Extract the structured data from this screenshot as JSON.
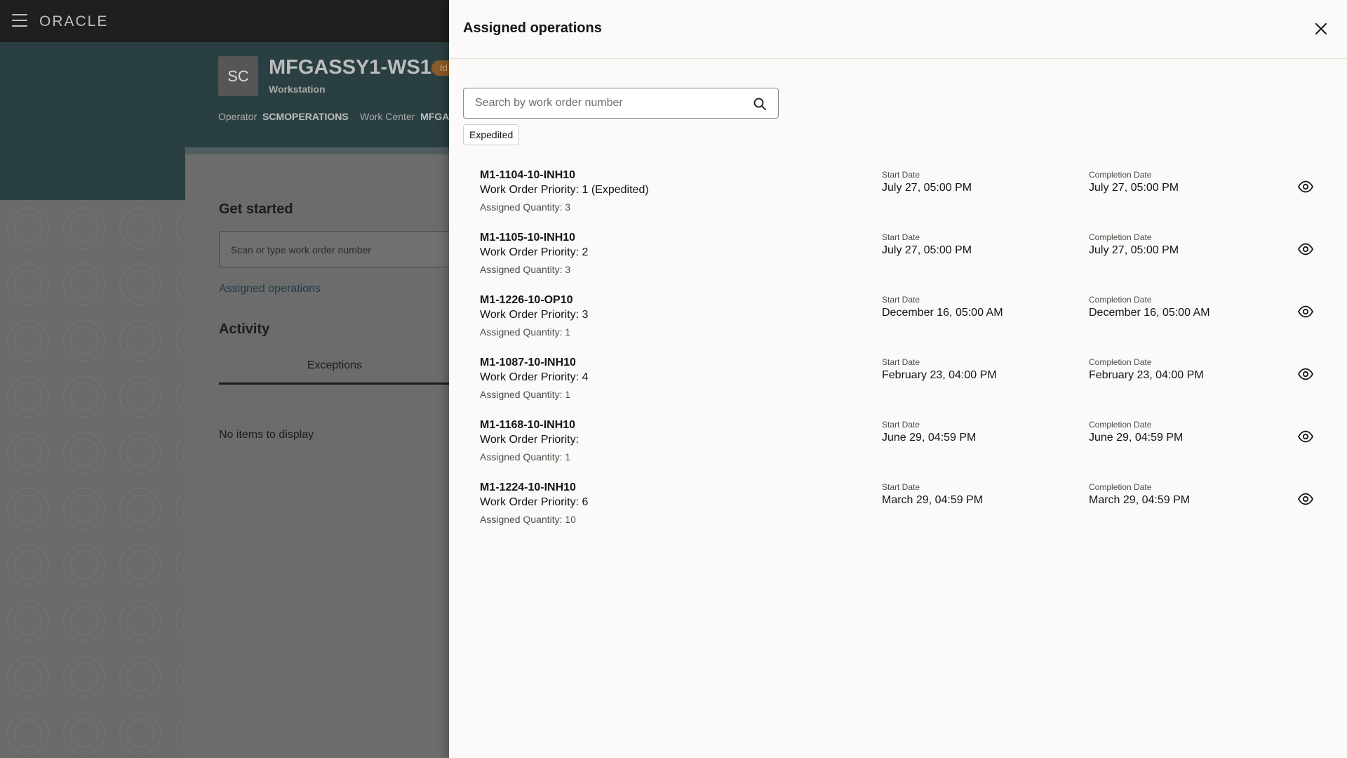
{
  "topbar": {
    "logo": "ORACLE"
  },
  "workstation": {
    "avatar": "SC",
    "name": "MFGASSY1-WS1",
    "badge": "Id",
    "type": "Workstation",
    "operator_label": "Operator",
    "operator_value": "SCMOPERATIONS",
    "work_center_label": "Work Center",
    "work_center_value": "MFGAS"
  },
  "background": {
    "get_started": "Get started",
    "scan_placeholder": "Scan or type work order number",
    "assigned_link": "Assigned operations",
    "activity": "Activity",
    "tab_exceptions": "Exceptions",
    "no_items": "No items to display"
  },
  "drawer": {
    "title": "Assigned operations",
    "search_placeholder": "Search by work order number",
    "chip": "Expedited",
    "start_label": "Start Date",
    "completion_label": "Completion Date",
    "rows": [
      {
        "number": "M1-1104-10-INH10",
        "priority": "Work Order Priority: 1 (Expedited)",
        "quantity": "Assigned Quantity: 3",
        "start": "July 27, 05:00 PM",
        "completion": "July 27, 05:00 PM"
      },
      {
        "number": "M1-1105-10-INH10",
        "priority": "Work Order Priority: 2",
        "quantity": "Assigned Quantity: 3",
        "start": "July 27, 05:00 PM",
        "completion": "July 27, 05:00 PM"
      },
      {
        "number": "M1-1226-10-OP10",
        "priority": "Work Order Priority: 3",
        "quantity": "Assigned Quantity: 1",
        "start": "December 16, 05:00 AM",
        "completion": "December 16, 05:00 AM"
      },
      {
        "number": "M1-1087-10-INH10",
        "priority": "Work Order Priority: 4",
        "quantity": "Assigned Quantity: 1",
        "start": "February 23, 04:00 PM",
        "completion": "February 23, 04:00 PM"
      },
      {
        "number": "M1-1168-10-INH10",
        "priority": "Work Order Priority:",
        "quantity": "Assigned Quantity: 1",
        "start": "June 29, 04:59 PM",
        "completion": "June 29, 04:59 PM"
      },
      {
        "number": "M1-1224-10-INH10",
        "priority": "Work Order Priority: 6",
        "quantity": "Assigned Quantity: 10",
        "start": "March 29, 04:59 PM",
        "completion": "March 29, 04:59 PM"
      }
    ]
  }
}
